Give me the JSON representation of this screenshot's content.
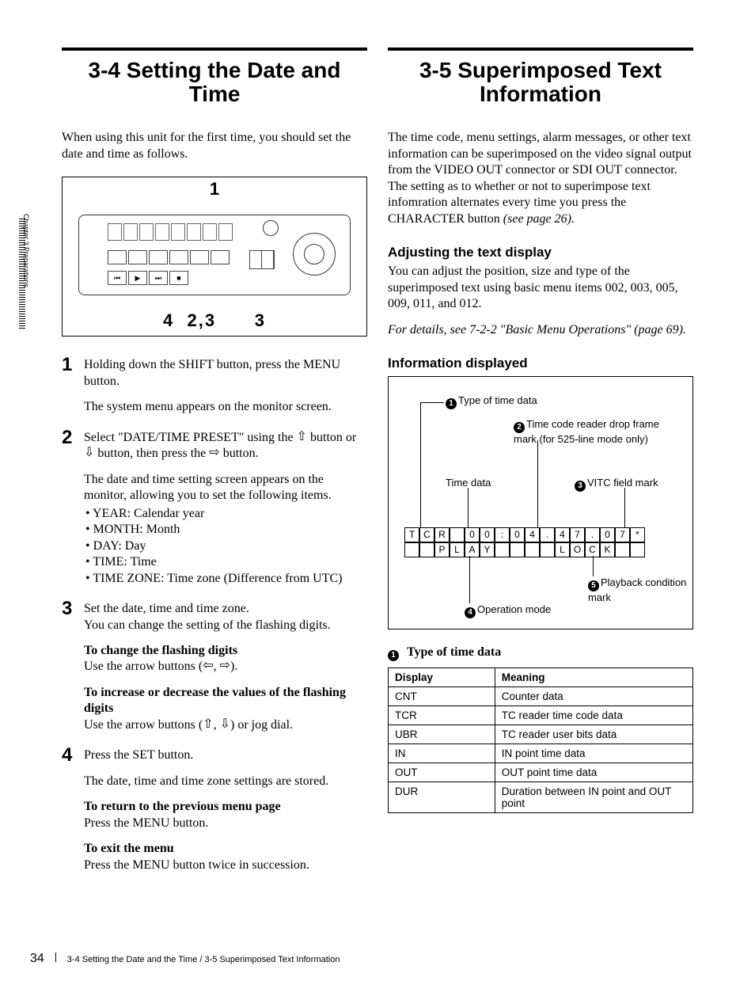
{
  "meta": {
    "page_number": "34",
    "chapter_tab": "Chapter 3  Preparations",
    "footer_text": "3-4 Setting the Date and the Time / 3-5 Superimposed Text Information"
  },
  "left": {
    "heading_num": "3-4",
    "heading_text": "Setting the Date and Time",
    "intro": "When using this unit for the first time, you should set the date and time as follows.",
    "figure": {
      "top": "1",
      "bottom_left": "4",
      "bottom_mid": "2,3",
      "bottom_right": "3"
    },
    "steps": [
      {
        "n": "1",
        "paras": [
          "Holding down the SHIFT button, press the MENU button.",
          "The system menu appears on the monitor screen."
        ]
      },
      {
        "n": "2",
        "paras": [
          "Select \"DATE/TIME PRESET\" using the ↑ button or ↓ button, then press the → button.",
          "The date and time setting screen appears on the monitor, allowing you to set the following items."
        ],
        "items": [
          "YEAR: Calendar year",
          "MONTH: Month",
          "DAY: Day",
          "TIME: Time",
          "TIME ZONE: Time zone (Difference from UTC)"
        ]
      },
      {
        "n": "3",
        "paras": [
          "Set the date, time and time zone.",
          "You can change the setting of the flashing digits."
        ],
        "sub": [
          {
            "head": "To change the flashing digits",
            "body": "Use the arrow buttons (←, →)."
          },
          {
            "head": "To increase or decrease the values of the flashing digits",
            "body": "Use the arrow buttons (↑, ↓) or jog dial."
          }
        ]
      },
      {
        "n": "4",
        "paras": [
          " Press the SET button.",
          "The date, time and time zone settings are stored."
        ],
        "sub": [
          {
            "head": "To return to the previous menu page",
            "body": "Press the MENU button."
          },
          {
            "head": "To exit the menu",
            "body": "Press the MENU button twice in succession."
          }
        ]
      }
    ]
  },
  "right": {
    "heading_num": "3-5",
    "heading_text": "Superimposed Text Information",
    "intro": "The time code, menu settings, alarm messages, or other text information can be superimposed on the video signal output from the VIDEO OUT connector or SDI OUT connector. The setting as to whether or not to superimpose text infomration alternates every time you press the CHARACTER button ",
    "intro_ital": "(see page 26).",
    "h2_adjust": "Adjusting the text display",
    "adjust_p": "You can adjust the position, size and type of the superimposed text using basic menu items 002, 003, 005, 009, 011, and 012.",
    "adjust_ref": "For details, see 7-2-2 \"Basic Menu Operations\" (page 69).",
    "h2_info": "Information displayed",
    "callouts": {
      "c1": "Type of time data",
      "c2": "Time code reader drop frame mark (for 525-line mode only)",
      "timedata": "Time data",
      "c3": "VITC field mark",
      "c4": "Operation mode",
      "c5": "Playback condition mark"
    },
    "display": {
      "row1": [
        "T",
        "C",
        "R",
        "",
        "0",
        "0",
        ":",
        "0",
        "4",
        ".",
        "4",
        "7",
        ".",
        "0",
        "7",
        "*"
      ],
      "row2": [
        "",
        "",
        "P",
        "L",
        "A",
        "Y",
        "",
        "",
        "",
        "",
        "L",
        "O",
        "C",
        "K",
        "",
        ""
      ]
    },
    "table_title": "Type of time data",
    "table": {
      "headers": [
        "Display",
        "Meaning"
      ],
      "rows": [
        [
          "CNT",
          "Counter data"
        ],
        [
          "TCR",
          "TC reader time code data"
        ],
        [
          "UBR",
          "TC reader user bits data"
        ],
        [
          "IN",
          "IN point time data"
        ],
        [
          "OUT",
          "OUT point time data"
        ],
        [
          "DUR",
          "Duration between IN point and OUT point"
        ]
      ]
    }
  }
}
